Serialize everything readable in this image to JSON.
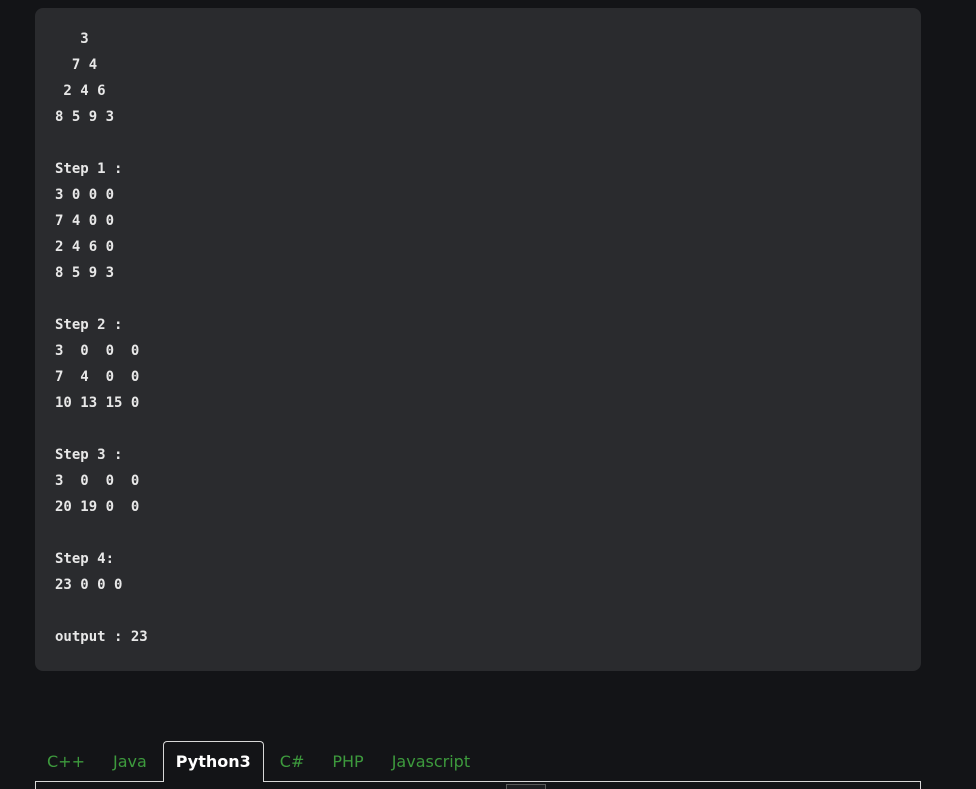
{
  "code_block": {
    "lines": [
      "   3",
      "  7 4",
      " 2 4 6",
      "8 5 9 3",
      "",
      "Step 1 :",
      "3 0 0 0",
      "7 4 0 0",
      "2 4 6 0",
      "8 5 9 3",
      "",
      "Step 2 :",
      "3  0  0  0",
      "7  4  0  0",
      "10 13 15 0",
      "",
      "Step 3 :",
      "3  0  0  0",
      "20 19 0  0",
      "",
      "Step 4:",
      "23 0 0 0",
      "",
      "output : 23"
    ]
  },
  "language_tabs": {
    "items": [
      {
        "label": "C++"
      },
      {
        "label": "Java"
      },
      {
        "label": "Python3"
      },
      {
        "label": "C#"
      },
      {
        "label": "PHP"
      },
      {
        "label": "Javascript"
      }
    ],
    "active": "Python3"
  },
  "colors": {
    "page_bg": "#131417",
    "code_bg": "#2a2b2e",
    "code_text": "#e8e8e8",
    "tab_text": "#3d9a3d",
    "tab_active_text": "#ffffff"
  }
}
